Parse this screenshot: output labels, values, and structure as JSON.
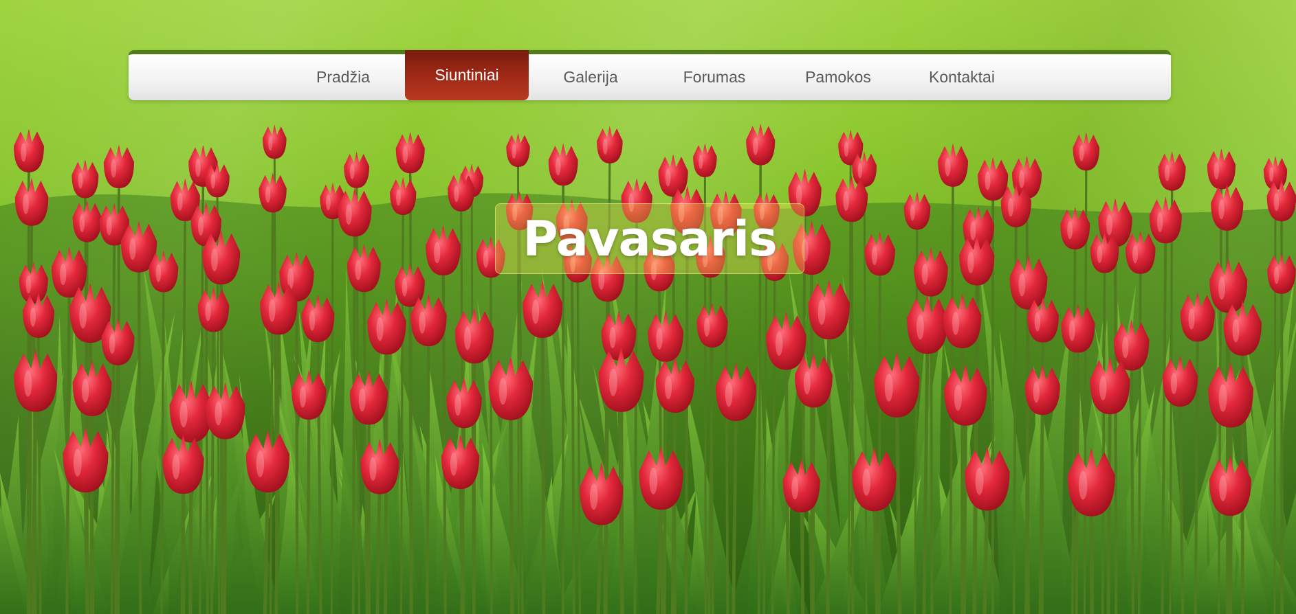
{
  "nav": {
    "items": [
      {
        "label": "Pradžia",
        "active": false
      },
      {
        "label": "Siuntiniai",
        "active": true
      },
      {
        "label": "Galerija",
        "active": false
      },
      {
        "label": "Forumas",
        "active": false
      },
      {
        "label": "Pamokos",
        "active": false
      },
      {
        "label": "Kontaktai",
        "active": false
      }
    ]
  },
  "hero": {
    "title": "Pavasaris"
  },
  "colors": {
    "nav_accent": "#4e7d19",
    "nav_active": "#a12a17",
    "nav_text": "#5a5a5a",
    "title_text": "#ffffff"
  },
  "background": {
    "icon": "tulip-field-photo"
  }
}
